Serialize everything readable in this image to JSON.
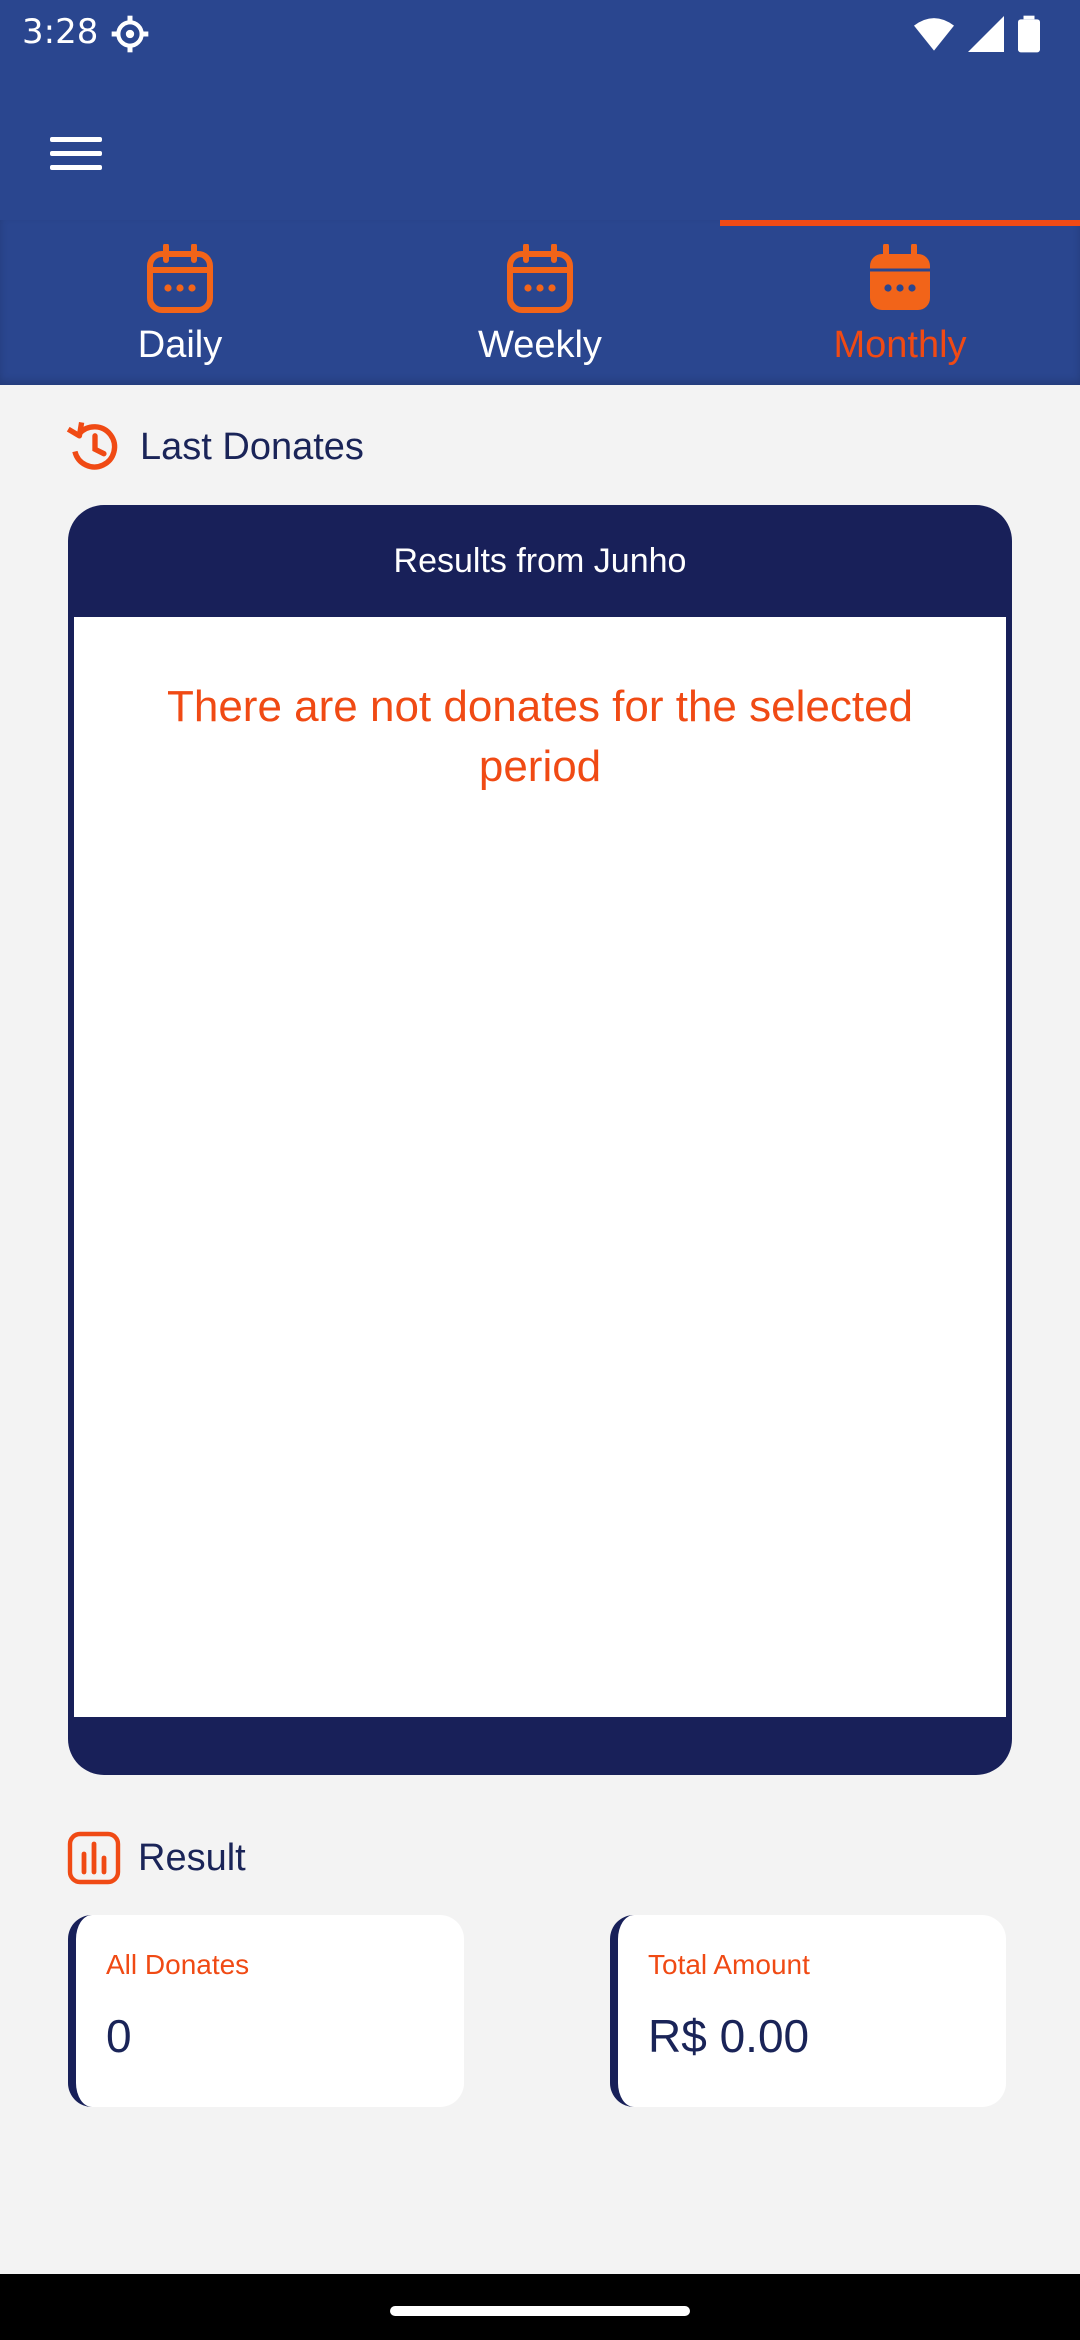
{
  "status": {
    "time": "3:28"
  },
  "tabs": [
    {
      "label": "Daily",
      "active": false
    },
    {
      "label": "Weekly",
      "active": false
    },
    {
      "label": "Monthly",
      "active": true
    }
  ],
  "last_donates": {
    "title": "Last Donates",
    "card_header": "Results from Junho",
    "empty_message": "There are not donates for the selected period"
  },
  "result": {
    "title": "Result",
    "all_donates_label": "All Donates",
    "all_donates_value": "0",
    "total_amount_label": "Total Amount",
    "total_amount_value": "R$ 0.00"
  },
  "colors": {
    "primary": "#2a468f",
    "dark": "#182059",
    "accent": "#f04a14"
  },
  "icons": {
    "status": [
      "gear-icon",
      "wifi-icon",
      "signal-icon",
      "battery-icon"
    ],
    "menu": "hamburger-menu-icon",
    "tabs": "calendar-icon",
    "last_donates": "history-icon",
    "result": "bar-chart-icon"
  }
}
